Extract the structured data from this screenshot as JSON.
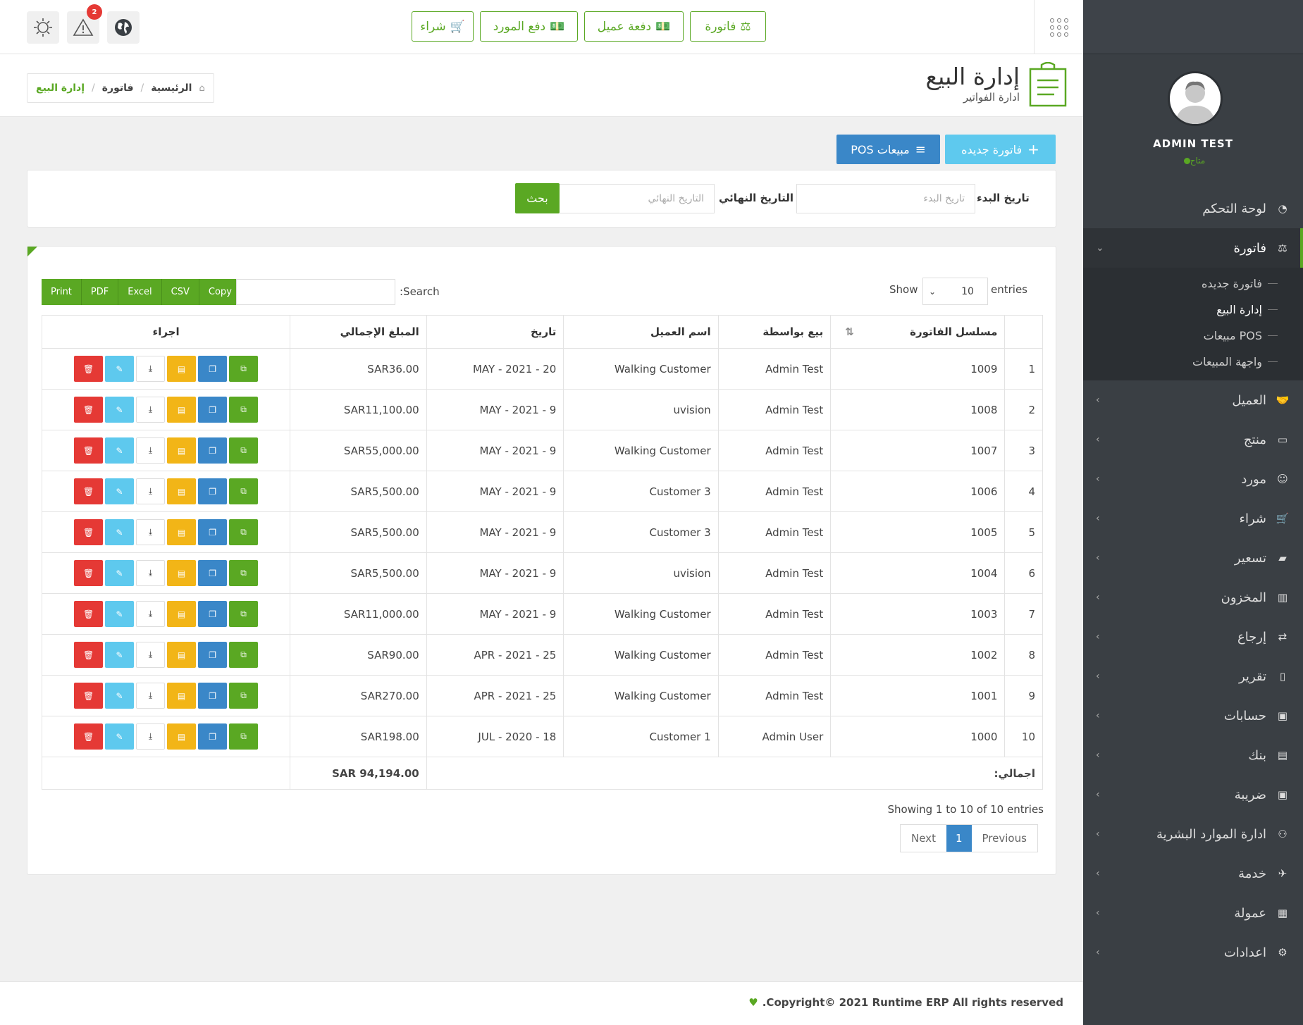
{
  "topbar": {
    "badge_count": "2",
    "quick_buttons": [
      "فاتورة",
      "دفعة عميل",
      "دفع المورد",
      "شراء"
    ]
  },
  "breadcrumb": {
    "home": "الرئيسية",
    "section": "فاتورة",
    "current": "إدارة البيع"
  },
  "page": {
    "title": "إدارة البيع",
    "subtitle": "ادارة الفواتير"
  },
  "actions": {
    "new_invoice": "فاتورة جديده",
    "pos_sales": "مبيعات POS"
  },
  "filter": {
    "start_label": "تاريخ البدء",
    "start_placeholder": "تاريخ البدء",
    "end_label": "التاريخ النهائي",
    "end_placeholder": "التاريخ النهائي",
    "search_button": "بحث"
  },
  "table_controls": {
    "export": [
      "Print",
      "PDF",
      "Excel",
      "CSV",
      "Copy"
    ],
    "search_label": ":Search",
    "show_label": "Show",
    "page_size": "10",
    "entries_label": "entries"
  },
  "table": {
    "headers": [
      "مسلسل الفاتورة",
      "بيع بواسطة",
      "اسم العميل",
      "تاريخ",
      "المبلغ الإجمالي",
      "اجراء"
    ],
    "rows": [
      {
        "n": "1",
        "invoice": "1009",
        "by": "Admin Test",
        "customer": "Walking Customer",
        "date": "MAY - 2021 - 20",
        "amount": "SAR36.00"
      },
      {
        "n": "2",
        "invoice": "1008",
        "by": "Admin Test",
        "customer": "uvision",
        "date": "MAY - 2021 - 9",
        "amount": "SAR11,100.00"
      },
      {
        "n": "3",
        "invoice": "1007",
        "by": "Admin Test",
        "customer": "Walking Customer",
        "date": "MAY - 2021 - 9",
        "amount": "SAR55,000.00"
      },
      {
        "n": "4",
        "invoice": "1006",
        "by": "Admin Test",
        "customer": "Customer 3",
        "date": "MAY - 2021 - 9",
        "amount": "SAR5,500.00"
      },
      {
        "n": "5",
        "invoice": "1005",
        "by": "Admin Test",
        "customer": "Customer 3",
        "date": "MAY - 2021 - 9",
        "amount": "SAR5,500.00"
      },
      {
        "n": "6",
        "invoice": "1004",
        "by": "Admin Test",
        "customer": "uvision",
        "date": "MAY - 2021 - 9",
        "amount": "SAR5,500.00"
      },
      {
        "n": "7",
        "invoice": "1003",
        "by": "Admin Test",
        "customer": "Walking Customer",
        "date": "MAY - 2021 - 9",
        "amount": "SAR11,000.00"
      },
      {
        "n": "8",
        "invoice": "1002",
        "by": "Admin Test",
        "customer": "Walking Customer",
        "date": "APR - 2021 - 25",
        "amount": "SAR90.00"
      },
      {
        "n": "9",
        "invoice": "1001",
        "by": "Admin Test",
        "customer": "Walking Customer",
        "date": "APR - 2021 - 25",
        "amount": "SAR270.00"
      },
      {
        "n": "10",
        "invoice": "1000",
        "by": "Admin User",
        "customer": "Customer 1",
        "date": "JUL - 2020 - 18",
        "amount": "SAR198.00"
      }
    ],
    "total_label": "اجمالي:",
    "total_value": "SAR 94,194.00"
  },
  "pagination": {
    "showing": "Showing 1 to 10 of 10 entries",
    "next": "Next",
    "current": "1",
    "previous": "Previous"
  },
  "footer": {
    "copyright": ".Copyright© 2021 Runtime ERP All rights reserved"
  },
  "sidebar": {
    "user_name": "ADMIN TEST",
    "user_status": "متاح",
    "menu": [
      {
        "label": "لوحة التحكم",
        "icon": "dashboard-icon",
        "has_children": false
      },
      {
        "label": "فاتورة",
        "icon": "scale-icon",
        "active": true,
        "has_children": true
      },
      {
        "label": "العميل",
        "icon": "handshake-icon",
        "has_children": true
      },
      {
        "label": "منتج",
        "icon": "box-icon",
        "has_children": true
      },
      {
        "label": "مورد",
        "icon": "user-icon",
        "has_children": true
      },
      {
        "label": "شراء",
        "icon": "cart-icon",
        "has_children": true
      },
      {
        "label": "تسعير",
        "icon": "book-icon",
        "has_children": true
      },
      {
        "label": "المخزون",
        "icon": "chart-icon",
        "has_children": true
      },
      {
        "label": "إرجاع",
        "icon": "return-icon",
        "has_children": true
      },
      {
        "label": "تقرير",
        "icon": "report-icon",
        "has_children": true
      },
      {
        "label": "حسابات",
        "icon": "money-icon",
        "has_children": true
      },
      {
        "label": "بنك",
        "icon": "briefcase-icon",
        "has_children": true
      },
      {
        "label": "ضريبة",
        "icon": "money-icon",
        "has_children": true
      },
      {
        "label": "ادارة الموارد البشرية",
        "icon": "users-icon",
        "has_children": true
      },
      {
        "label": "خدمة",
        "icon": "service-icon",
        "has_children": true
      },
      {
        "label": "عمولة",
        "icon": "grid-icon",
        "has_children": true
      },
      {
        "label": "اعدادات",
        "icon": "gear-icon",
        "has_children": true
      }
    ],
    "submenu": [
      "فاتورة جديده",
      "إدارة البيع",
      "مبيعات POS",
      "واجهة المبيعات"
    ]
  },
  "colors": {
    "accent": "#5aa823",
    "sidebar": "#3a3f44",
    "info": "#5ec9ee",
    "primary": "#3a87c8",
    "danger": "#e53935",
    "warning": "#f2b517"
  }
}
